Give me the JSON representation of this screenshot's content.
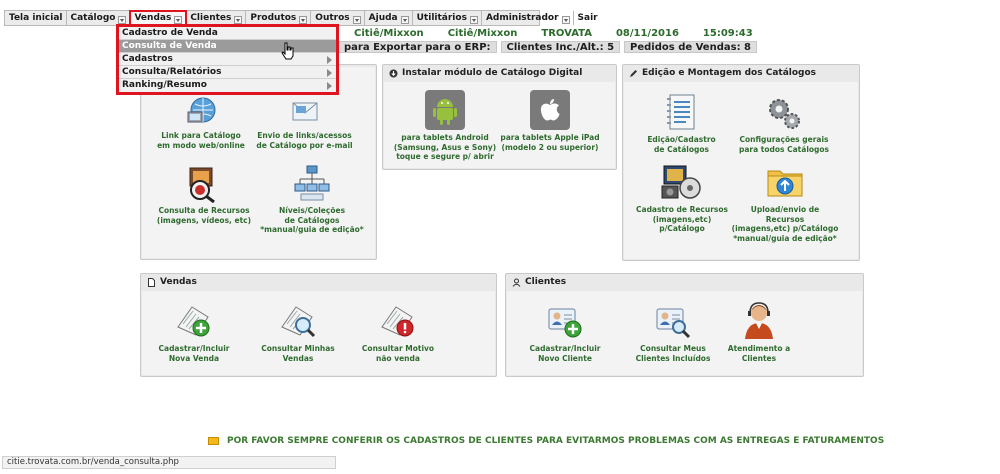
{
  "menu": [
    {
      "label": "Tela inicial",
      "caret": false
    },
    {
      "label": "Catálogo",
      "caret": true
    },
    {
      "label": "Vendas",
      "caret": true,
      "active": true
    },
    {
      "label": "Clientes",
      "caret": true
    },
    {
      "label": "Produtos",
      "caret": true
    },
    {
      "label": "Outros",
      "caret": true
    },
    {
      "label": "Ajuda",
      "caret": true
    },
    {
      "label": "Utilitários",
      "caret": true
    },
    {
      "label": "Administrador",
      "caret": true
    },
    {
      "label": "Sair",
      "caret": false
    }
  ],
  "info": {
    "company1": "Citiê/Mixxon",
    "company2": "Citiê/Mixxon",
    "system": "TROVATA",
    "date": "08/11/2016",
    "time": "15:09:43"
  },
  "counters": {
    "export": "para Exportar para o ERP:",
    "clients": "Clientes Inc./Alt.: 5",
    "orders": "Pedidos de Vendas: 8"
  },
  "dropdown": [
    {
      "label": "Cadastro de Venda",
      "submenu": false
    },
    {
      "label": "Consulta de Venda",
      "submenu": false,
      "hover": true
    },
    {
      "label": "Cadastros",
      "submenu": true
    },
    {
      "label": "Consulta/Relatórios",
      "submenu": true
    },
    {
      "label": "Ranking/Resumo",
      "submenu": true
    }
  ],
  "catalog_panel": {
    "tiles": [
      {
        "line1": "Link para Catálogo",
        "line2": "em modo web/online",
        "line3": "",
        "icon": "web-link-icon"
      },
      {
        "line1": "Envio de links/acessos",
        "line2": "de Catálogo por e-mail",
        "line3": "",
        "icon": "email-icon"
      },
      {
        "line1": "Consulta de Recursos",
        "line2": "(imagens, vídeos, etc)",
        "line3": "",
        "icon": "media-search-icon"
      },
      {
        "line1": "Níveis/Coleções",
        "line2": "de Catálogos",
        "line3": "*manual/guia de edição*",
        "icon": "hierarchy-icon"
      }
    ]
  },
  "digital_panel": {
    "title": "Instalar módulo de Catálogo Digital",
    "tiles": [
      {
        "line1": "para tablets Android",
        "line2": "(Samsung, Asus e Sony)",
        "line3": "toque e segure p/ abrir",
        "icon": "android-icon"
      },
      {
        "line1": "para tablets Apple iPad",
        "line2": "(modelo 2 ou superior)",
        "line3": "",
        "icon": "apple-icon"
      }
    ]
  },
  "edit_panel": {
    "title": "Edição e Montagem dos Catálogos",
    "tiles": [
      {
        "line1": "Edição/Cadastro",
        "line2": "de Catálogos",
        "line3": "",
        "line4": "",
        "icon": "catalog-edit-icon"
      },
      {
        "line1": "Configurações gerais",
        "line2": "para todos Catálogos",
        "line3": "",
        "line4": "",
        "icon": "gears-icon"
      },
      {
        "line1": "Cadastro de Recursos",
        "line2": "(imagens,etc) p/Catálogo",
        "line3": "",
        "line4": "",
        "icon": "media-register-icon"
      },
      {
        "line1": "Upload/envio de",
        "line2": "Recursos",
        "line3": "(imagens,etc) p/Catálogo",
        "line4": "*manual/guia de edição*",
        "icon": "upload-folder-icon"
      }
    ]
  },
  "sales_panel": {
    "title": "Vendas",
    "tiles": [
      {
        "line1": "Cadastrar/Incluir",
        "line2": "Nova Venda",
        "icon": "add-sale-icon"
      },
      {
        "line1": "Consultar Minhas",
        "line2": "Vendas",
        "icon": "search-sales-icon"
      },
      {
        "line1": "Consultar Motivo",
        "line2": "não venda",
        "icon": "alert-sales-icon"
      }
    ]
  },
  "clients_panel": {
    "title": "Clientes",
    "tiles": [
      {
        "line1": "Cadastrar/Incluir",
        "line2": "Novo Cliente",
        "icon": "add-client-icon"
      },
      {
        "line1": "Consultar Meus",
        "line2": "Clientes Incluídos",
        "icon": "search-clients-icon"
      },
      {
        "line1": "Atendimento a",
        "line2": "Clientes",
        "icon": "support-agent-icon"
      }
    ]
  },
  "notice": "POR FAVOR SEMPRE CONFERIR OS CADASTROS DE CLIENTES PARA EVITARMOS PROBLEMAS COM AS ENTREGAS E FATURAMENTOS",
  "status_url": "citie.trovata.com.br/venda_consulta.php",
  "colors": {
    "highlight": "#e0141e",
    "link_green": "#2f6b2f",
    "panel_bg": "#e9e9e9"
  }
}
